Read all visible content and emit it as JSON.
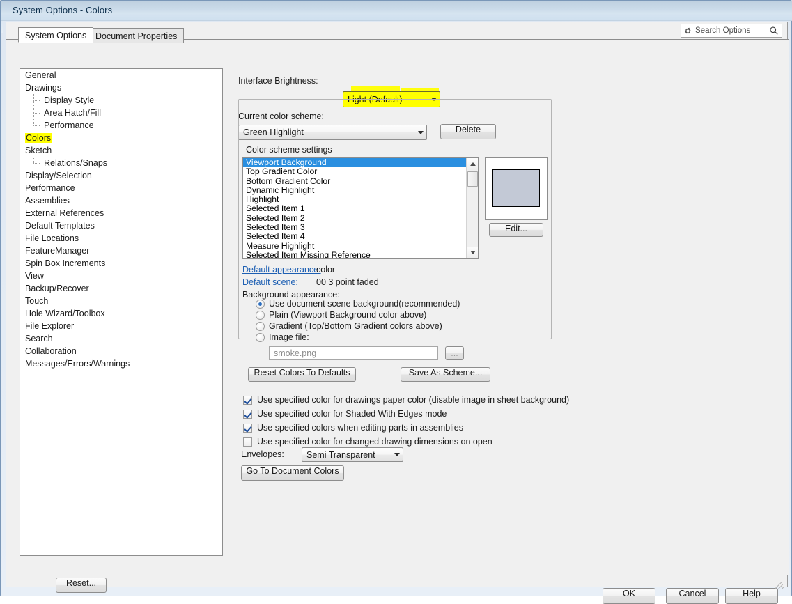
{
  "window": {
    "title": "System Options - Colors"
  },
  "tabs": [
    {
      "id": "system-options",
      "label": "System Options",
      "active": true
    },
    {
      "id": "document-properties",
      "label": "Document Properties",
      "active": false
    }
  ],
  "search": {
    "placeholder": "Search Options",
    "gear_icon": "gear-icon",
    "search_icon": "search-icon"
  },
  "tree": {
    "items": [
      {
        "label": "General",
        "level": 0,
        "highlighted": false
      },
      {
        "label": "Drawings",
        "level": 0,
        "highlighted": false
      },
      {
        "label": "Display Style",
        "level": 1,
        "highlighted": false
      },
      {
        "label": "Area Hatch/Fill",
        "level": 1,
        "highlighted": false
      },
      {
        "label": "Performance",
        "level": 1,
        "highlighted": false,
        "last": true
      },
      {
        "label": "Colors",
        "level": 0,
        "highlighted": true
      },
      {
        "label": "Sketch",
        "level": 0,
        "highlighted": false
      },
      {
        "label": "Relations/Snaps",
        "level": 1,
        "highlighted": false,
        "last": true
      },
      {
        "label": "Display/Selection",
        "level": 0,
        "highlighted": false
      },
      {
        "label": "Performance",
        "level": 0,
        "highlighted": false
      },
      {
        "label": "Assemblies",
        "level": 0,
        "highlighted": false
      },
      {
        "label": "External References",
        "level": 0,
        "highlighted": false
      },
      {
        "label": "Default Templates",
        "level": 0,
        "highlighted": false
      },
      {
        "label": "File Locations",
        "level": 0,
        "highlighted": false
      },
      {
        "label": "FeatureManager",
        "level": 0,
        "highlighted": false
      },
      {
        "label": "Spin Box Increments",
        "level": 0,
        "highlighted": false
      },
      {
        "label": "View",
        "level": 0,
        "highlighted": false
      },
      {
        "label": "Backup/Recover",
        "level": 0,
        "highlighted": false
      },
      {
        "label": "Touch",
        "level": 0,
        "highlighted": false
      },
      {
        "label": "Hole Wizard/Toolbox",
        "level": 0,
        "highlighted": false
      },
      {
        "label": "File Explorer",
        "level": 0,
        "highlighted": false
      },
      {
        "label": "Search",
        "level": 0,
        "highlighted": false
      },
      {
        "label": "Collaboration",
        "level": 0,
        "highlighted": false
      },
      {
        "label": "Messages/Errors/Warnings",
        "level": 0,
        "highlighted": false
      }
    ]
  },
  "reset_button": {
    "label": "Reset..."
  },
  "brightness": {
    "label": "Interface Brightness:",
    "value": "Light (Default)",
    "highlight_color": "#ffff00"
  },
  "color_scheme": {
    "label": "Current color scheme:",
    "value": "Green Highlight",
    "delete_button": "Delete"
  },
  "scheme_settings": {
    "group_title": "Color scheme settings",
    "items": [
      {
        "label": "Viewport Background",
        "selected": true
      },
      {
        "label": "Top Gradient Color",
        "selected": false
      },
      {
        "label": "Bottom Gradient Color",
        "selected": false
      },
      {
        "label": "Dynamic Highlight",
        "selected": false
      },
      {
        "label": "Highlight",
        "selected": false
      },
      {
        "label": "Selected Item 1",
        "selected": false
      },
      {
        "label": "Selected Item 2",
        "selected": false
      },
      {
        "label": "Selected Item 3",
        "selected": false
      },
      {
        "label": "Selected Item 4",
        "selected": false
      },
      {
        "label": "Measure Highlight",
        "selected": false
      },
      {
        "label": "Selected Item Missing Reference",
        "selected": false
      }
    ],
    "preview_color": "#c3c9d6",
    "edit_button": "Edit...",
    "default_appearance_label": "Default appearance:",
    "default_appearance_value": "color",
    "default_scene_label": "Default scene:",
    "default_scene_value": "00 3 point faded",
    "background_appearance_label": "Background appearance:",
    "radios": [
      {
        "label": "Use document scene background(recommended)",
        "selected": true
      },
      {
        "label": "Plain (Viewport Background color above)",
        "selected": false
      },
      {
        "label": "Gradient (Top/Bottom Gradient colors above)",
        "selected": false
      },
      {
        "label": "Image file:",
        "selected": false
      }
    ],
    "image_file_value": "smoke.png",
    "browse_button": "...",
    "reset_colors_button": "Reset Colors To Defaults",
    "save_as_scheme_button": "Save As Scheme..."
  },
  "checkboxes": [
    {
      "label": "Use specified color for drawings paper color (disable image in sheet background)",
      "checked": true
    },
    {
      "label": "Use specified color for Shaded With Edges mode",
      "checked": true
    },
    {
      "label": "Use specified colors when editing parts in assemblies",
      "checked": true
    },
    {
      "label": "Use specified color for changed drawing dimensions on open",
      "checked": false
    }
  ],
  "envelopes": {
    "label": "Envelopes:",
    "value": "Semi Transparent"
  },
  "go_to_document_colors": {
    "label": "Go To Document Colors"
  },
  "footer": {
    "ok": "OK",
    "cancel": "Cancel",
    "help": "Help"
  }
}
